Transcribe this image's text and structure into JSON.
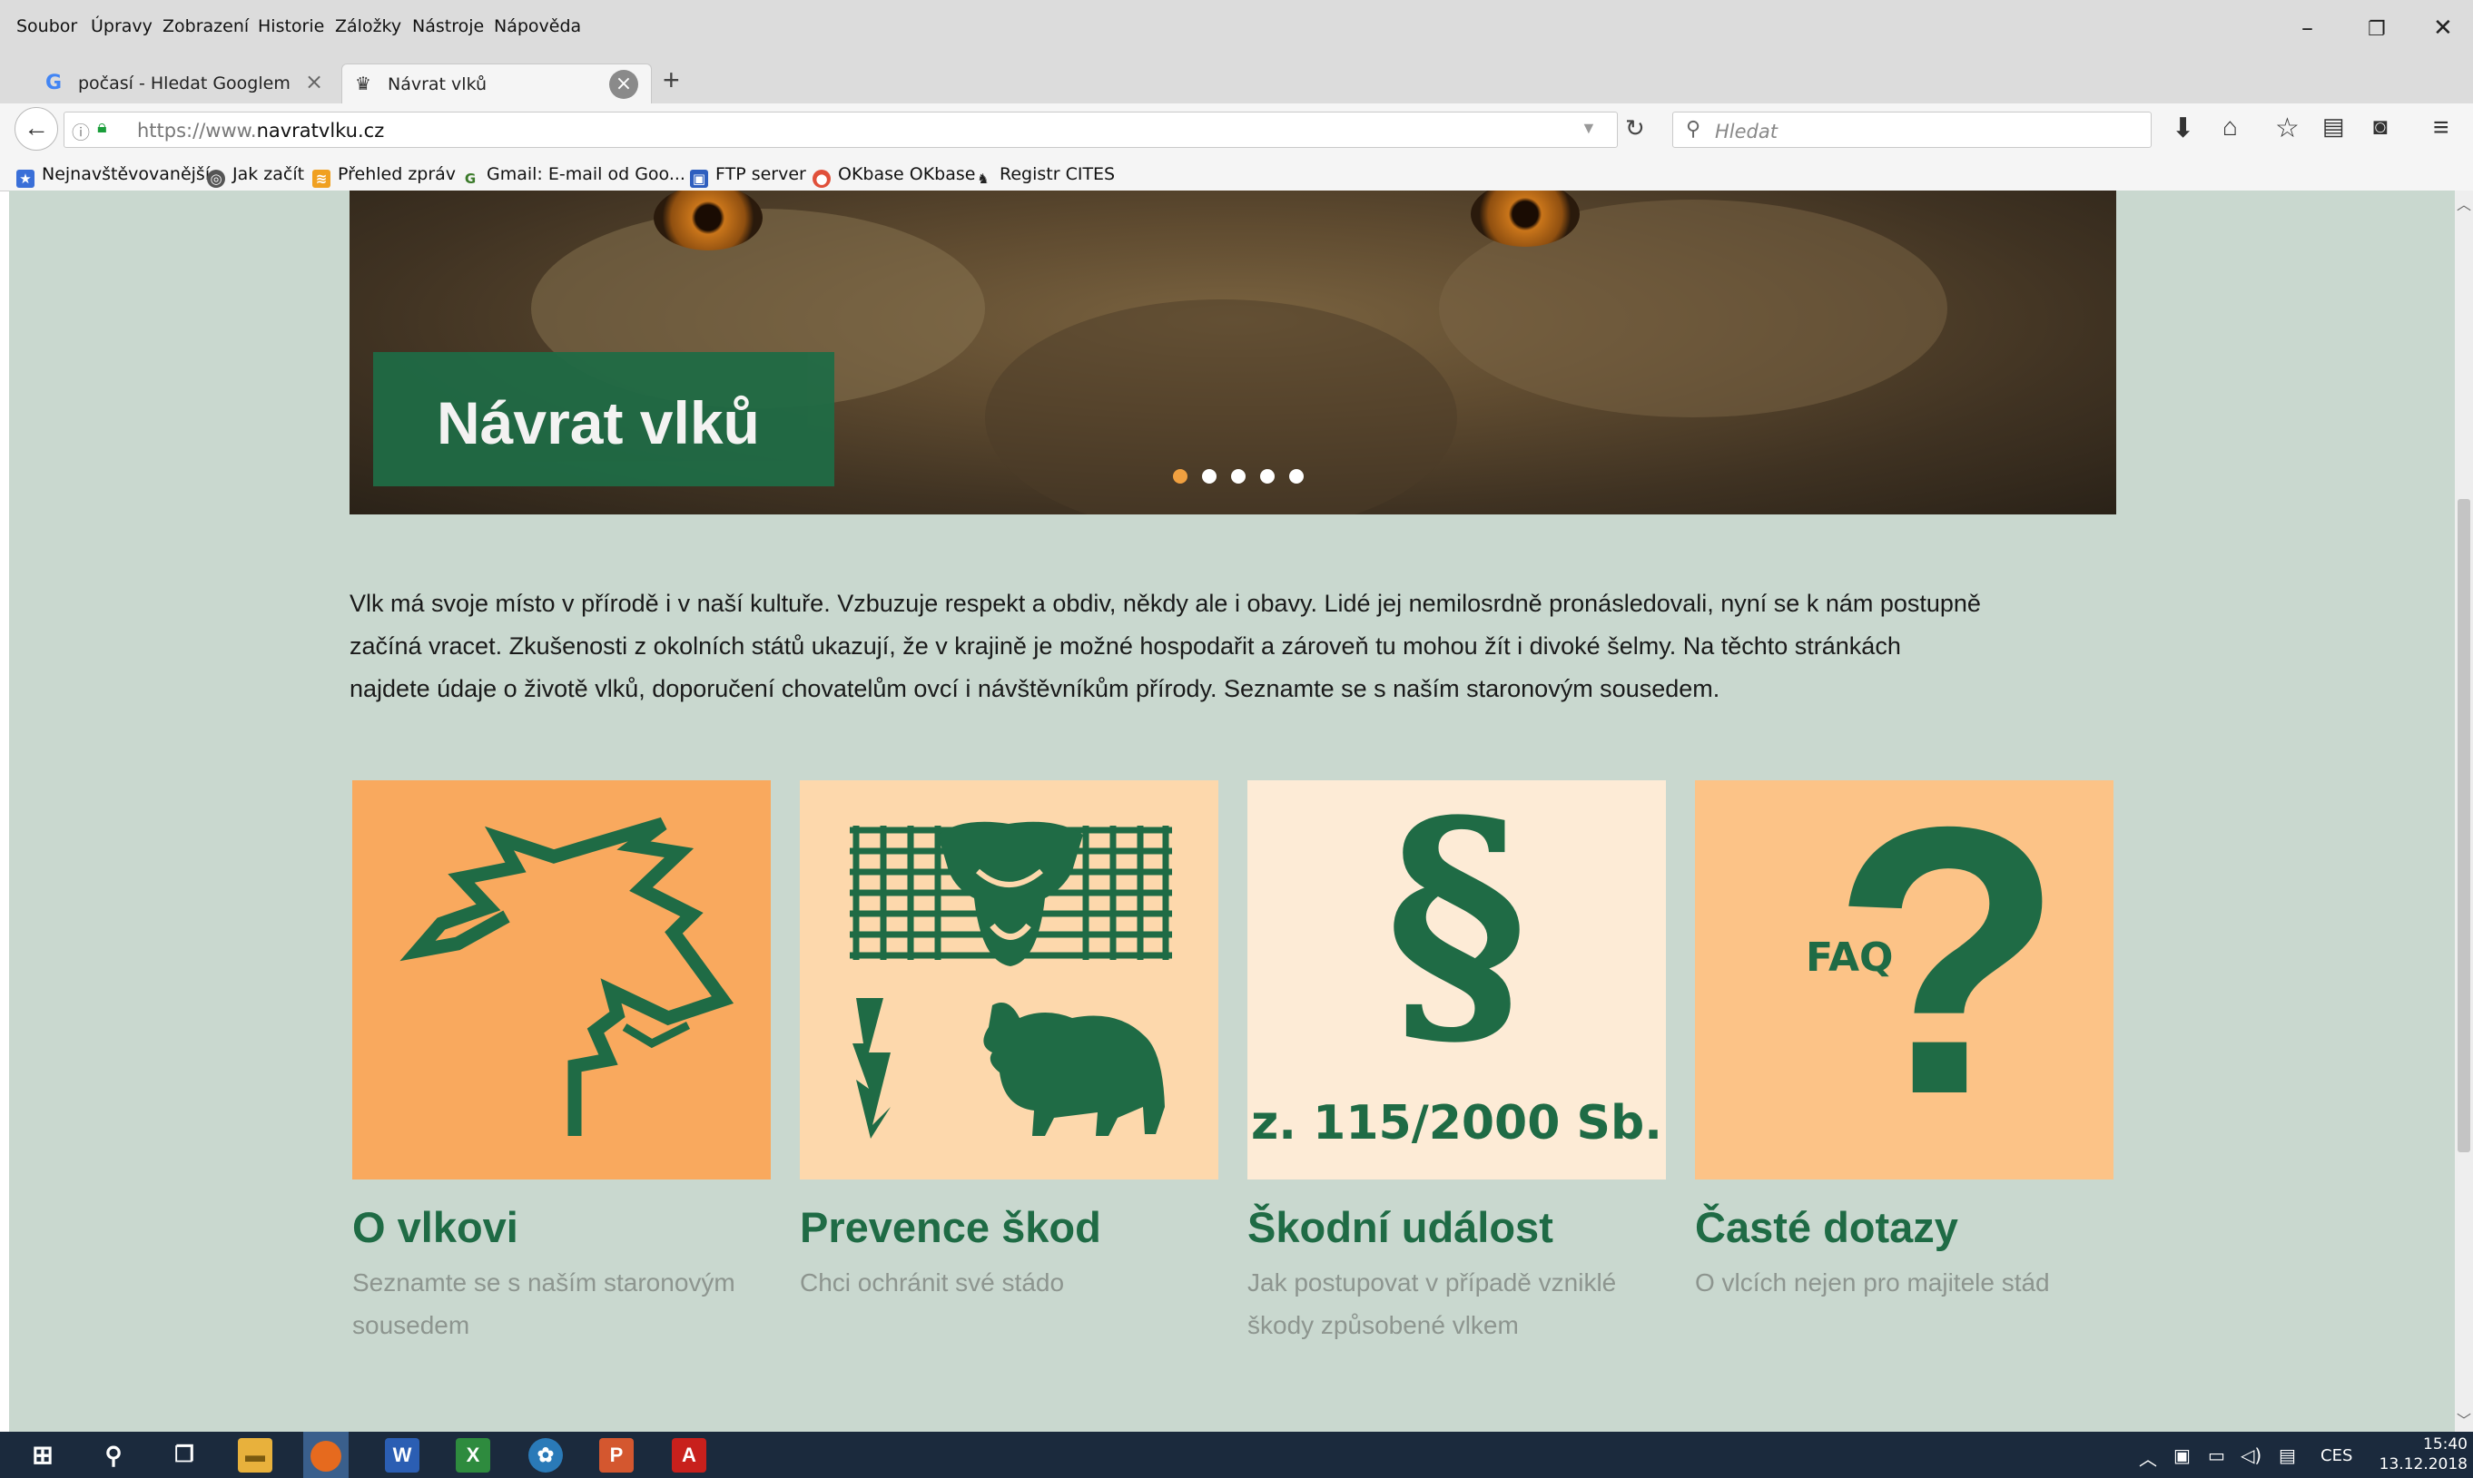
{
  "menubar": {
    "items": [
      "Soubor",
      "Úpravy",
      "Zobrazení",
      "Historie",
      "Záložky",
      "Nástroje",
      "Nápověda"
    ]
  },
  "tabs": [
    {
      "label": "počasí - Hledat Googlem",
      "icon": "google-icon",
      "active": false
    },
    {
      "label": "Návrat vlků",
      "icon": "wolf-icon",
      "active": true
    }
  ],
  "navbar": {
    "url_prefix": "https://www.",
    "url_domain": "navratvlku.cz",
    "search_placeholder": "Hledat"
  },
  "bookmarks": [
    {
      "label": "Nejnavštěvovanější",
      "icon": "most-visited-icon",
      "color": "#3a6fd8"
    },
    {
      "label": "Jak začít",
      "icon": "firefox-icon",
      "color": "#555555"
    },
    {
      "label": "Přehled zpráv",
      "icon": "rss-icon",
      "color": "#f0a020"
    },
    {
      "label": "Gmail: E-mail od Goo...",
      "icon": "google-icon",
      "color": "#3b7a2a"
    },
    {
      "label": "FTP server",
      "icon": "computer-icon",
      "color": "#2f5fbf"
    },
    {
      "label": "OKbase OKbase",
      "icon": "okbase-icon",
      "color": "#e0503a"
    },
    {
      "label": "Registr CITES",
      "icon": "cites-icon",
      "color": "#222222"
    }
  ],
  "hero": {
    "title": "Návrat vlků",
    "slide_count": 5,
    "active_slide": 1
  },
  "intro": {
    "lines": [
      "Vlk má svoje místo v přírodě i v naší kultuře. Vzbuzuje respekt a obdiv, někdy ale i obavy. Lidé jej nemilosrdně pronásledovali, nyní se k nám postupně",
      "začíná vracet. Zkušenosti z okolních států ukazují,  že v  krajině je možné hospodařit a zároveň tu mohou žít i divoké šelmy. Na těchto stránkách",
      "najdete údaje o životě vlků, doporučení chovatelům ovcí i návštěvníkům přírody. Seznamte se s naším staronovým sousedem."
    ]
  },
  "cards": [
    {
      "title": "O vlkovi",
      "subtitle_lines": [
        "Seznamte se s naším staronovým",
        "sousedem"
      ],
      "icon": "wolf-head-icon",
      "bg": "#f9a95e"
    },
    {
      "title": "Prevence škod",
      "subtitle_lines": [
        "Chci ochránit své stádo"
      ],
      "icon": "fence-sheep-dog-icon",
      "bg": "#fdd8ac"
    },
    {
      "title": "Škodní událost",
      "subtitle_lines": [
        "Jak postupovat v případě vzniklé",
        "škody způsobené vlkem"
      ],
      "icon": "paragraph-icon",
      "bg": "#fdebd6",
      "icon_text": "z. 115/2000 Sb."
    },
    {
      "title": "Časté dotazy",
      "subtitle_lines": [
        "O vlcích nejen pro majitele stád"
      ],
      "icon": "question-icon",
      "bg": "#fcc387",
      "icon_text": "FAQ"
    }
  ],
  "taskbar": {
    "language": "CES",
    "time": "15:40",
    "date": "13.12.2018"
  },
  "colors": {
    "brand_green": "#1f6b45",
    "page_bg": "#c9d8cf",
    "accent_orange": "#f0a040"
  }
}
